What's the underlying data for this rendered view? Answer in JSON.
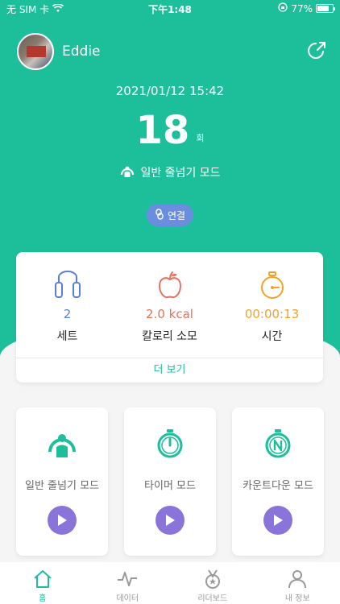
{
  "status_bar": {
    "carrier": "无 SIM 卡",
    "time": "下午1:48",
    "battery": "77%",
    "battery_level": 0.77
  },
  "profile": {
    "name": "Eddie"
  },
  "session": {
    "datetime": "2021/01/12 15:42",
    "count": "18",
    "count_unit": "회",
    "mode": "일반 줄넘기 모드"
  },
  "connect_label": "연결",
  "stats": [
    {
      "value": "2",
      "label": "세트",
      "icon": "jump-rope-icon",
      "color": "#5b7fd6"
    },
    {
      "value": "2.0 kcal",
      "label": "칼로리 소모",
      "icon": "apple-icon",
      "color": "#e8705f"
    },
    {
      "value": "00:00:13",
      "label": "시간",
      "icon": "stopwatch-icon",
      "color": "#f0a326"
    }
  ],
  "more_label": "더 보기",
  "modes": [
    {
      "name": "일반 줄넘기 모드",
      "icon": "jump-rope-person-icon"
    },
    {
      "name": "타이머 모드",
      "icon": "timer-icon"
    },
    {
      "name": "카운트다운 모드",
      "icon": "countdown-icon"
    }
  ],
  "tabs": [
    {
      "label": "홈",
      "icon": "home-icon",
      "active": true
    },
    {
      "label": "데이터",
      "icon": "chart-icon",
      "active": false
    },
    {
      "label": "리더보드",
      "icon": "medal-icon",
      "active": false
    },
    {
      "label": "내 정보",
      "icon": "person-icon",
      "active": false
    }
  ],
  "colors": {
    "accent": "#1dbf9b",
    "play": "#8a73d9",
    "connect": "#6a8de0"
  }
}
